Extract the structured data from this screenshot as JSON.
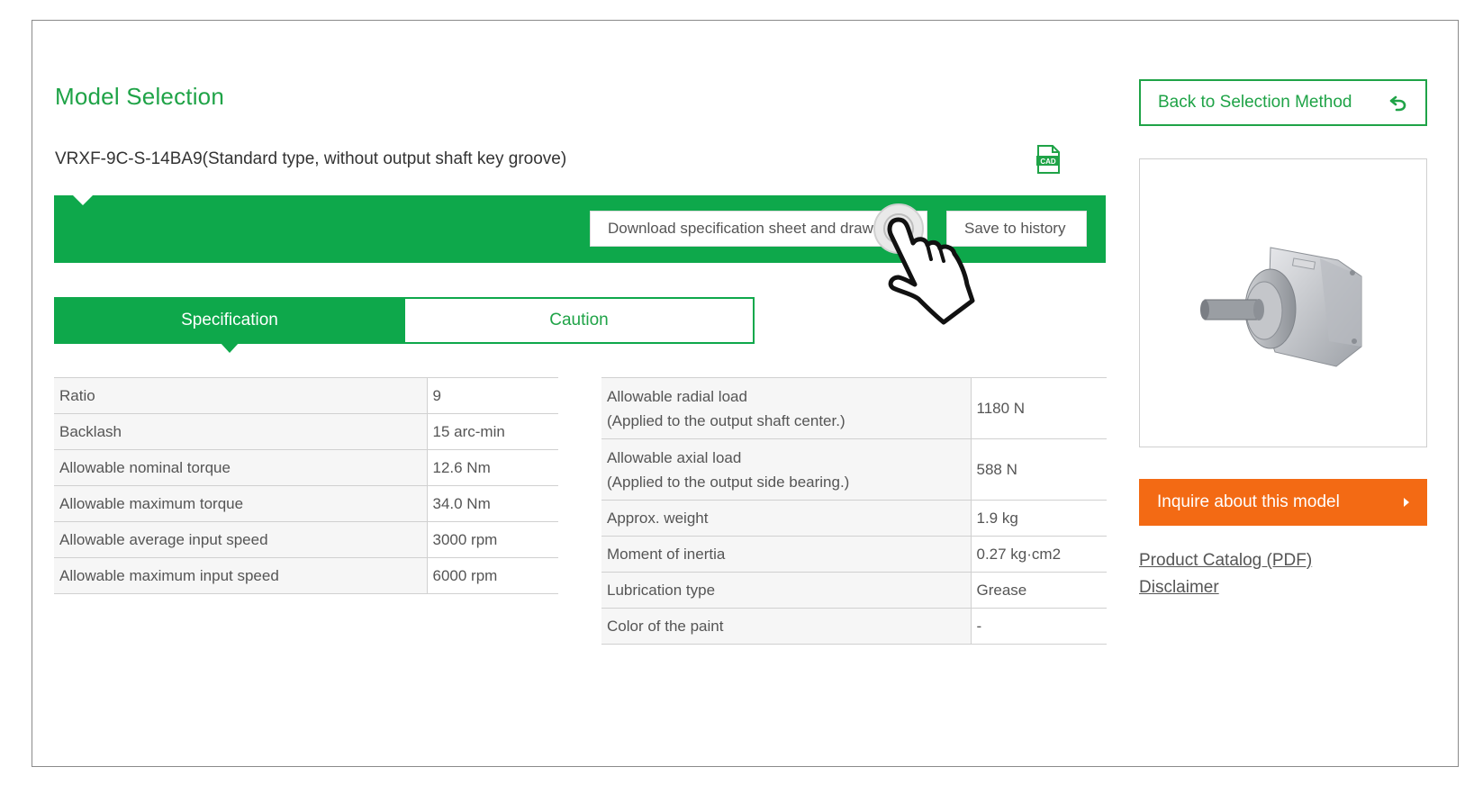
{
  "header": {
    "title": "Model Selection",
    "model_name": "VRXF-9C-S-14BA9(Standard type, without output shaft key groove)",
    "cad_label": "CAD"
  },
  "toolbar": {
    "download_label": "Download specification sheet and drawings",
    "save_label": "Save to history"
  },
  "tabs": [
    {
      "label": "Specification",
      "active": true
    },
    {
      "label": "Caution",
      "active": false
    }
  ],
  "spec_left": [
    {
      "label": "Ratio",
      "value": "9"
    },
    {
      "label": "Backlash",
      "value": "15 arc-min"
    },
    {
      "label": "Allowable nominal torque",
      "value": "12.6 Nm"
    },
    {
      "label": "Allowable maximum torque",
      "value": "34.0 Nm"
    },
    {
      "label": "Allowable average input speed",
      "value": "3000 rpm"
    },
    {
      "label": "Allowable maximum input speed",
      "value": "6000 rpm"
    }
  ],
  "spec_right": [
    {
      "label": "Allowable radial load",
      "sublabel": "(Applied to the output shaft center.)",
      "value": "1180 N"
    },
    {
      "label": "Allowable axial load",
      "sublabel": "(Applied to the output side bearing.)",
      "value": "588 N"
    },
    {
      "label": "Approx. weight",
      "value": "1.9 kg"
    },
    {
      "label": "Moment of inertia",
      "value": "0.27 kg·cm2"
    },
    {
      "label": "Lubrication type",
      "value": "Grease"
    },
    {
      "label": "Color of the paint",
      "value": "-"
    }
  ],
  "sidebar": {
    "back_label": "Back to Selection Method",
    "inquire_label": "Inquire about this model",
    "catalog_link": "Product Catalog (PDF)",
    "disclaimer_link": "Disclaimer"
  },
  "colors": {
    "brand_green": "#0ea84b",
    "text_green": "#1fa347",
    "accent_orange": "#f36a14"
  },
  "icons": [
    "cad-file-icon",
    "back-arrow-icon",
    "pointing-hand-icon",
    "chevron-right-icon"
  ]
}
